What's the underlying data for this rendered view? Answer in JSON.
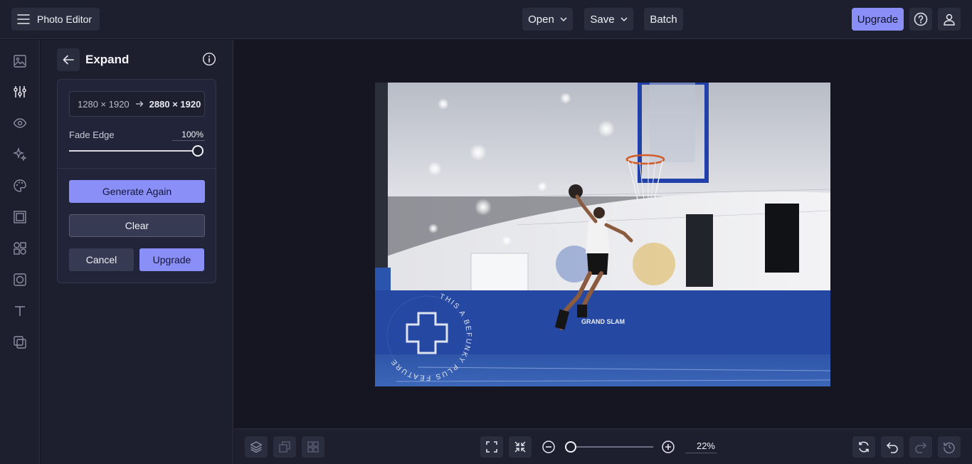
{
  "app": {
    "title": "Photo Editor",
    "menu_icon": "hamburger-icon"
  },
  "toolbar": {
    "open_label": "Open",
    "save_label": "Save",
    "batch_label": "Batch",
    "upgrade_label": "Upgrade",
    "help_icon": "help-icon",
    "account_icon": "user-icon"
  },
  "rail": {
    "items": [
      {
        "icon": "image-icon"
      },
      {
        "icon": "adjust-sliders-icon"
      },
      {
        "icon": "eye-icon"
      },
      {
        "icon": "sparkle-icon"
      },
      {
        "icon": "palette-icon"
      },
      {
        "icon": "frame-icon"
      },
      {
        "icon": "shapes-icon"
      },
      {
        "icon": "overlay-icon"
      },
      {
        "icon": "text-icon"
      },
      {
        "icon": "layers-icon"
      }
    ],
    "active_index": 1
  },
  "panel": {
    "title": "Expand",
    "dims_from": "1280 × 1920",
    "dims_to": "2880 × 1920",
    "fade_label": "Fade Edge",
    "fade_value": "100%",
    "fade_level": 1.0,
    "generate_label": "Generate Again",
    "clear_label": "Clear",
    "cancel_label": "Cancel",
    "upgrade_label": "Upgrade"
  },
  "canvas": {
    "watermark_text": "THIS A BEFUNKY PLUS FEATURE",
    "banner_text": "GRAND SLAM"
  },
  "bottombar": {
    "zoom_value": "22%",
    "zoom_level": 0.05
  },
  "colors": {
    "accent": "#8a8ff8",
    "background": "#151621",
    "panel": "#1d1f2e"
  }
}
